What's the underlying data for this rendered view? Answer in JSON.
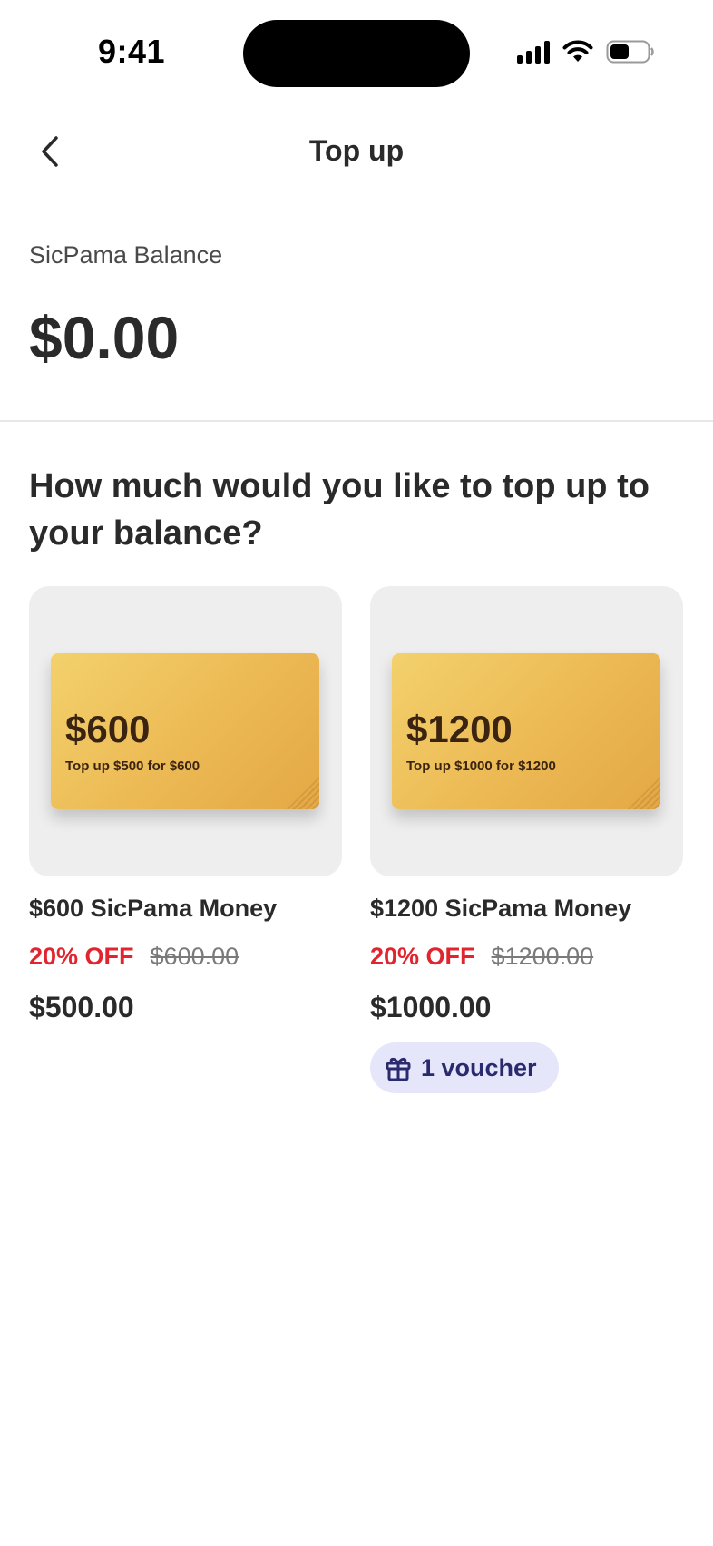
{
  "status_bar": {
    "time": "9:41"
  },
  "nav": {
    "title": "Top up"
  },
  "balance": {
    "label": "SicPama Balance",
    "value": "$0.00"
  },
  "question": "How much would you like to top up to your balance?",
  "products": [
    {
      "card_amount": "$600",
      "card_subtitle": "Top up $500 for $600",
      "name": "$600 SicPama Money",
      "discount": "20% OFF",
      "original_price": "$600.00",
      "price": "$500.00"
    },
    {
      "card_amount": "$1200",
      "card_subtitle": "Top up $1000 for $1200",
      "name": "$1200 SicPama Money",
      "discount": "20% OFF",
      "original_price": "$1200.00",
      "price": "$1000.00",
      "voucher": "1 voucher"
    }
  ],
  "colors": {
    "discount": "#e0252f",
    "card_gold": "#ecb954",
    "voucher_bg": "#e6e6fb",
    "voucher_text": "#2a2a6e"
  },
  "icons": [
    "back-chevron-icon",
    "cellular-signal-icon",
    "wifi-icon",
    "battery-icon",
    "gift-icon"
  ]
}
